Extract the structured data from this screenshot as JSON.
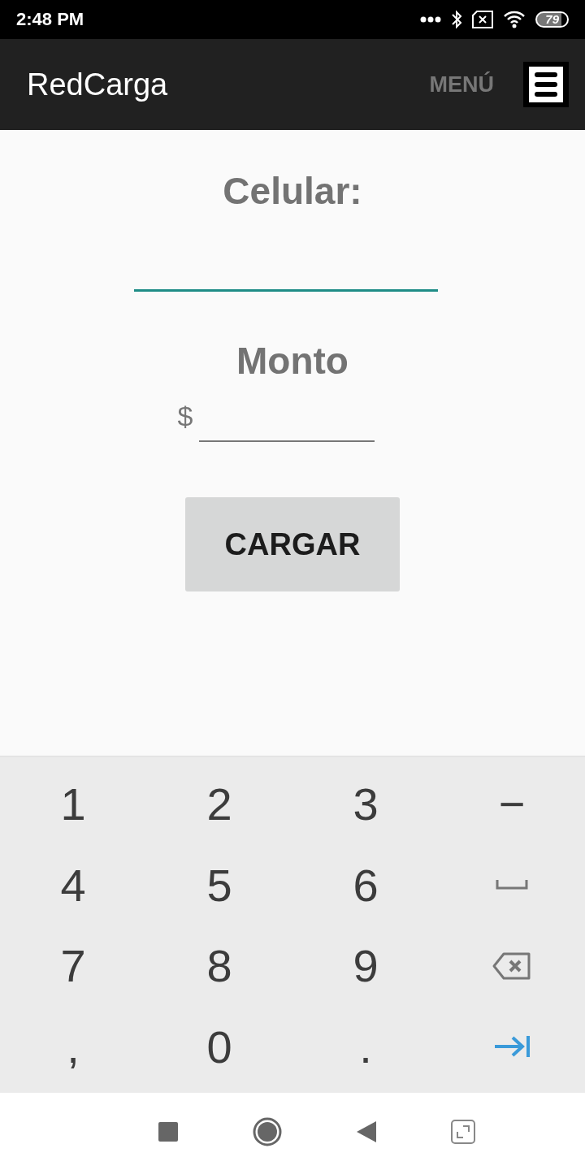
{
  "status_bar": {
    "time": "2:48 PM",
    "battery": "79"
  },
  "app_bar": {
    "title": "RedCarga",
    "menu_label": "MENÚ"
  },
  "form": {
    "phone_label": "Celular:",
    "phone_focused": true,
    "amount_label": "Monto",
    "currency": "$",
    "submit": "CARGAR"
  },
  "keyboard": {
    "rows": [
      [
        {
          "kind": "text",
          "label": "1"
        },
        {
          "kind": "text",
          "label": "2"
        },
        {
          "kind": "text",
          "label": "3"
        },
        {
          "kind": "text",
          "label": "−"
        }
      ],
      [
        {
          "kind": "text",
          "label": "4"
        },
        {
          "kind": "text",
          "label": "5"
        },
        {
          "kind": "text",
          "label": "6"
        },
        {
          "kind": "space"
        }
      ],
      [
        {
          "kind": "text",
          "label": "7"
        },
        {
          "kind": "text",
          "label": "8"
        },
        {
          "kind": "text",
          "label": "9"
        },
        {
          "kind": "backspace"
        }
      ],
      [
        {
          "kind": "text",
          "label": ","
        },
        {
          "kind": "text",
          "label": "0"
        },
        {
          "kind": "text",
          "label": "."
        },
        {
          "kind": "next"
        }
      ]
    ]
  }
}
